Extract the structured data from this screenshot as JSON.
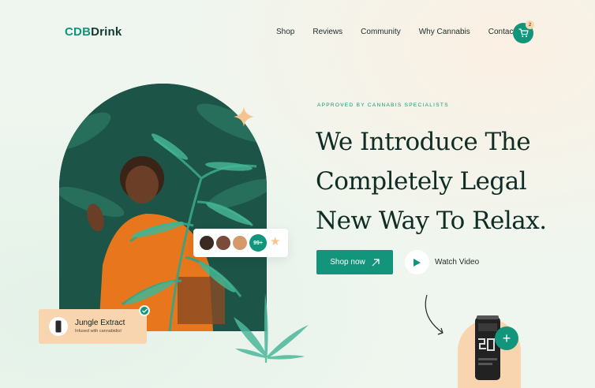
{
  "brand": {
    "accent": "CDB",
    "rest": "Drink"
  },
  "nav": {
    "items": [
      "Shop",
      "Reviews",
      "Community",
      "Why Cannabis",
      "Contact"
    ]
  },
  "cart": {
    "count": "2"
  },
  "hero": {
    "eyebrow": "APPROVED BY CANNABIS SPECIALISTS",
    "headline_lines": [
      "We Introduce The",
      "Completely Legal",
      "New Way To Relax."
    ],
    "shop_button": "Shop now",
    "watch_label": "Watch Video"
  },
  "reviews": {
    "count_label": "99+"
  },
  "product": {
    "title": "Jungle Extract",
    "subtitle": "Infused with cannabidiol"
  },
  "colors": {
    "primary": "#12957a",
    "peach": "#f8d4af",
    "dark": "#0f2c25"
  },
  "icons": [
    "cart-icon",
    "arrow-up-right-icon",
    "play-icon",
    "star-icon",
    "check-icon",
    "plus-icon",
    "sparkle-icon"
  ]
}
